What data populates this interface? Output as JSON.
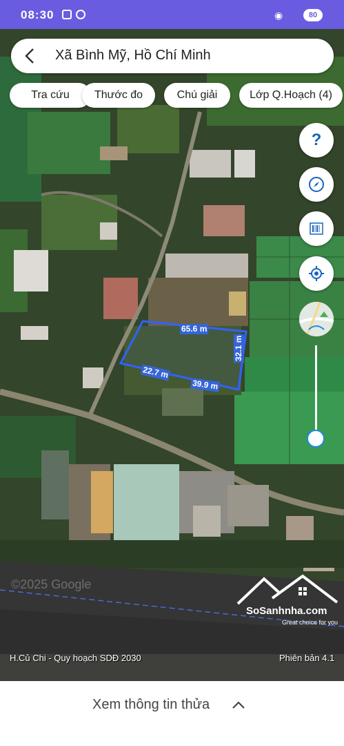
{
  "status_bar": {
    "time": "08:30",
    "battery": "80"
  },
  "search": {
    "title": "Xã Bình Mỹ, Hồ Chí Minh"
  },
  "chips": [
    "Tra cứu",
    "Thước đo",
    "Chú giải",
    "Lớp Q.Hoạch (4)"
  ],
  "map_buttons": [
    "help-icon",
    "compass-icon",
    "barcode-icon",
    "my-location-icon",
    "map-layer-icon"
  ],
  "measurements": {
    "top": "65.6 m",
    "right": "32.1 m",
    "bottom": "39.9 m",
    "left": "22.7 m"
  },
  "map_footer": {
    "left": "H.Củ Chi - Quy hoạch SDĐ 2030",
    "right": "Phiên bản 4.1"
  },
  "watermark": {
    "copyright": "©2025 Google",
    "brand": "SoSanhnha.com",
    "slogan": "Great choice for you"
  },
  "bottom_panel": {
    "label": "Xem thông tin thửa"
  },
  "colors": {
    "accent": "#1e88e5",
    "parcel_outline": "#2f63ff",
    "status_bar": "#6a5ce0"
  }
}
